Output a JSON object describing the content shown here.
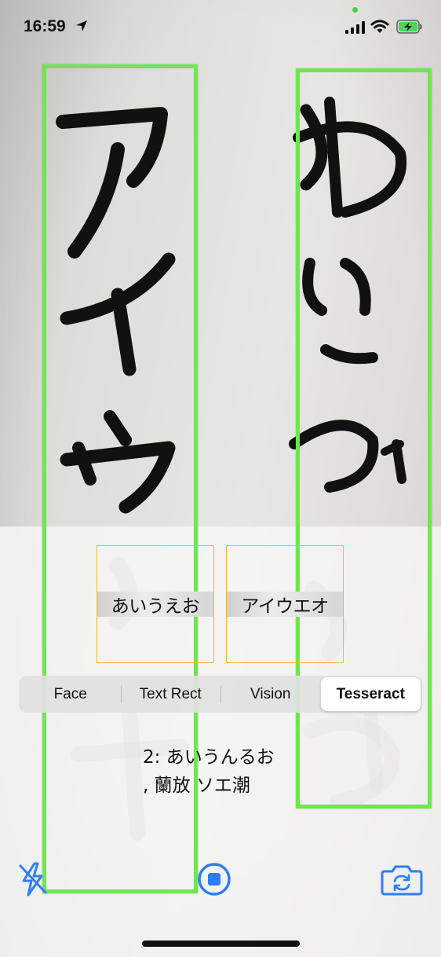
{
  "status_bar": {
    "time": "16:59",
    "location_icon": "location-arrow-icon",
    "signal_icon": "cellular-signal-icon",
    "wifi_icon": "wifi-icon",
    "battery_icon": "battery-charging-icon"
  },
  "crops": [
    {
      "text": "あいうえお"
    },
    {
      "text": "アイウエオ"
    }
  ],
  "modes": [
    {
      "label": "Face",
      "active": false
    },
    {
      "label": "Text Rect",
      "active": false
    },
    {
      "label": "Vision",
      "active": false
    },
    {
      "label": "Tesseract",
      "active": true
    }
  ],
  "result": {
    "line1": "2: あいうんるお",
    "line2": ", 蘭放 ソエ潮"
  },
  "controls": {
    "flash_icon": "flash-off-icon",
    "record_icon": "stop-recording-icon",
    "flip_icon": "camera-flip-icon"
  },
  "colors": {
    "detection_box": "#6fe64f",
    "crop_border": "#f0b733",
    "accent": "#2f7df6"
  }
}
